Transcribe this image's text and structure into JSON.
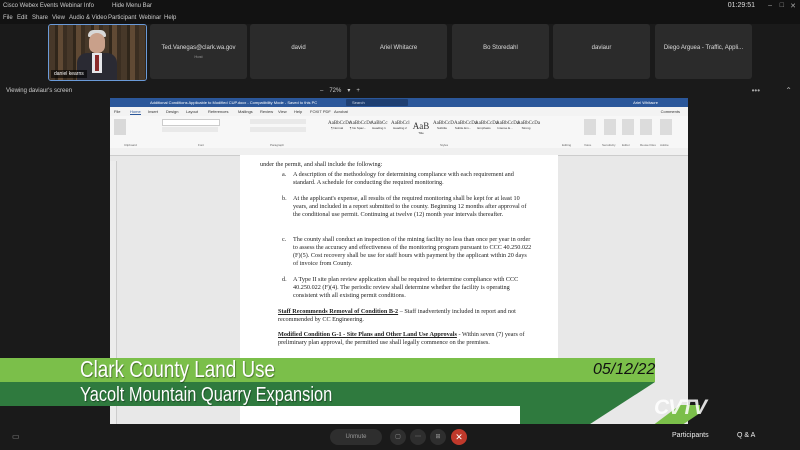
{
  "topbar": {
    "app_name": "Cisco Webex Events",
    "webinar_info": "Webinar Info",
    "hide_menu": "Hide Menu Bar",
    "clock": "01:29:51"
  },
  "menu": [
    "File",
    "Edit",
    "Share",
    "View",
    "Audio & Video",
    "Participant",
    "Webinar",
    "Help"
  ],
  "participants": [
    {
      "name": "daniel kearns",
      "sub": "",
      "video": true
    },
    {
      "name": "Ted.Vanegas@clark.wa.gov",
      "sub": "Host"
    },
    {
      "name": "david",
      "sub": ""
    },
    {
      "name": "Ariel Whitacre",
      "sub": ""
    },
    {
      "name": "Bo Storedahl",
      "sub": ""
    },
    {
      "name": "daviaur",
      "sub": ""
    },
    {
      "name": "Diego Arguea - Traffic, Appli...",
      "sub": ""
    }
  ],
  "share": {
    "viewing_label": "Viewing daviaur's screen",
    "zoom_level": "72%"
  },
  "word": {
    "doc_title": "Additional Conditions Applicable to Modified CUP.docx - Compatibility Mode - Saved to this PC",
    "search_placeholder": "Search",
    "user_name": "Ariel Whitacre",
    "tabs": [
      "File",
      "Home",
      "Insert",
      "Design",
      "Layout",
      "References",
      "Mailings",
      "Review",
      "View",
      "Help",
      "FOXIT PDF",
      "Acrobat"
    ],
    "comments_label": "Comments",
    "groups": [
      "Clipboard",
      "Font",
      "Paragraph",
      "Styles",
      "Editing",
      "Voice",
      "Sensitivity",
      "Editor",
      "Reuse Files",
      "Adobe"
    ],
    "styles": [
      {
        "sample": "AaBbCcDc",
        "label": "¶ Normal"
      },
      {
        "sample": "AaBbCcDc",
        "label": "¶ No Spac..."
      },
      {
        "sample": "AaBbCc",
        "label": "Heading 1"
      },
      {
        "sample": "AaBbCcl",
        "label": "Heading 2"
      },
      {
        "sample": "AaB",
        "label": "Title"
      },
      {
        "sample": "AaBbCcD",
        "label": "Subtitle"
      },
      {
        "sample": "AaBbCcDa",
        "label": "Subtle Em..."
      },
      {
        "sample": "AaBbCcDa",
        "label": "Emphasis"
      },
      {
        "sample": "AaBbCcDa",
        "label": "Intense E..."
      },
      {
        "sample": "AaBbCcDa",
        "label": "Strong"
      }
    ],
    "paragraphs": [
      {
        "marker": "",
        "text": "under the permit, and shall include the following:"
      },
      {
        "marker": "a.",
        "text": "A description of the methodology for determining compliance with each requirement and standard. A schedule for conducting the required monitoring."
      },
      {
        "marker": "b.",
        "text": "At the applicant's expense, all results of the required monitoring shall be kept for at least 10 years, and included in a report submitted to the county. Beginning 12 months after approval of the conditional use permit. Continuing at twelve (12) month year intervals thereafter."
      },
      {
        "marker": "c.",
        "text": "The county shall conduct an inspection of the mining facility no less than once per year in order to assess the accuracy and effectiveness of the monitoring program pursuant to CCC 40.250.022 (F)(5). Cost recovery shall be use for staff hours with payment by the applicant within 20 days of invoice from County."
      },
      {
        "marker": "d.",
        "text": "A Type II site plan review application shall be required to determine compliance with CCC 40.250.022 (F)(4). The periodic review shall determine whether the facility is operating consistent with all existing permit conditions."
      }
    ],
    "removal_bold": "Staff Recommends Removal of Condition B-2",
    "removal_rest": " – Staff inadvertently included in report and not recommended by CC Engineering.",
    "modified_bold": "Modified Condition G-1 - Site Plans and Other Land Use Approvals",
    "modified_rest": " - Within seven (7) years of preliminary plan approval, the permitted use shall legally commence on the premises."
  },
  "lower_third": {
    "title": "Clark County Land Use",
    "subtitle": "Yacolt Mountain Quarry Expansion",
    "date": "05/12/22",
    "logo": "CVTV"
  },
  "bottombar": {
    "unmute_label": "Unmute",
    "participants_label": "Participants",
    "qa_label": "Q & A"
  }
}
